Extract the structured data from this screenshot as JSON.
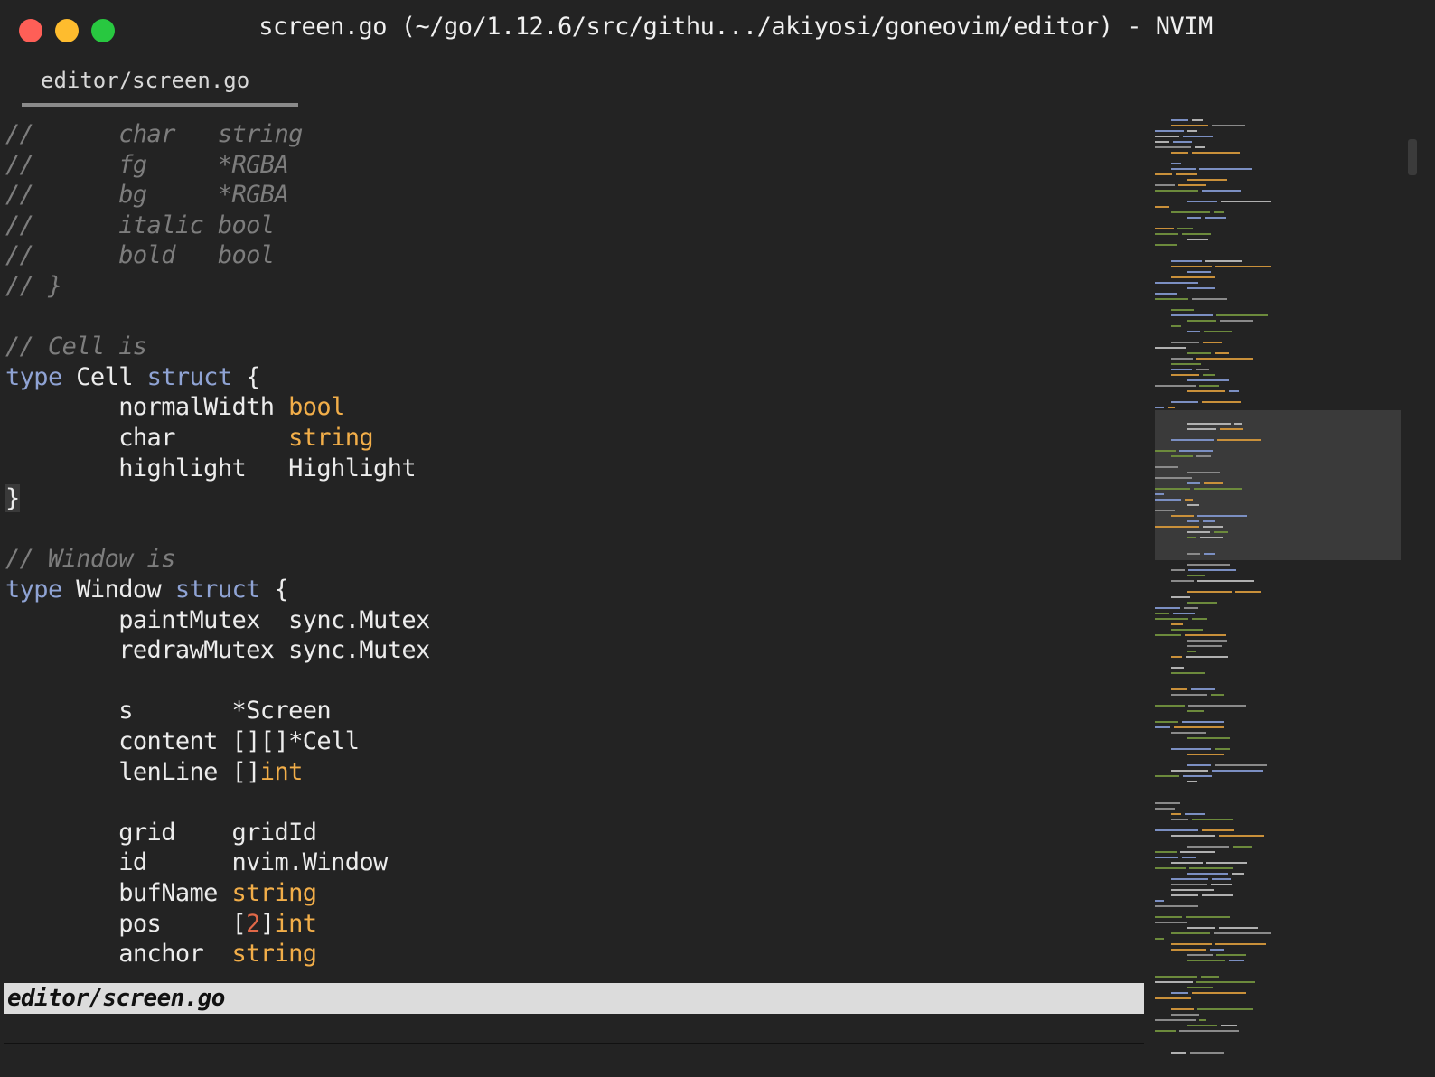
{
  "window": {
    "title": "screen.go (~/go/1.12.6/src/githu.../akiyosi/goneovim/editor) - NVIM"
  },
  "tabs": [
    {
      "label": "editor/screen.go",
      "active": true
    }
  ],
  "code": [
    [
      {
        "t": "//      char   string",
        "c": "c"
      }
    ],
    [
      {
        "t": "//      fg     *RGBA",
        "c": "c"
      }
    ],
    [
      {
        "t": "//      bg     *RGBA",
        "c": "c"
      }
    ],
    [
      {
        "t": "//      italic bool",
        "c": "c"
      }
    ],
    [
      {
        "t": "//      bold   bool",
        "c": "c"
      }
    ],
    [
      {
        "t": "// }",
        "c": "c"
      }
    ],
    [],
    [
      {
        "t": "// Cell is",
        "c": "c"
      }
    ],
    [
      {
        "t": "type",
        "c": "kw"
      },
      {
        "t": " Cell ",
        "c": "id"
      },
      {
        "t": "struct",
        "c": "kw"
      },
      {
        "t": " {",
        "c": "id"
      }
    ],
    [
      {
        "t": "        normalWidth ",
        "c": "id"
      },
      {
        "t": "bool",
        "c": "ty"
      }
    ],
    [
      {
        "t": "        char        ",
        "c": "id"
      },
      {
        "t": "string",
        "c": "ty"
      }
    ],
    [
      {
        "t": "        highlight   Highlight",
        "c": "id"
      }
    ],
    [
      {
        "t": "}",
        "c": "id brace-hl"
      }
    ],
    [],
    [
      {
        "t": "// Window is",
        "c": "c"
      }
    ],
    [
      {
        "t": "type",
        "c": "kw"
      },
      {
        "t": " Window ",
        "c": "id"
      },
      {
        "t": "struct",
        "c": "kw"
      },
      {
        "t": " {",
        "c": "id"
      }
    ],
    [
      {
        "t": "        paintMutex  sync.Mutex",
        "c": "id"
      }
    ],
    [
      {
        "t": "        redrawMutex sync.Mutex",
        "c": "id"
      }
    ],
    [],
    [
      {
        "t": "        s       *Screen",
        "c": "id"
      }
    ],
    [
      {
        "t": "        content [][]*Cell",
        "c": "id"
      }
    ],
    [
      {
        "t": "        lenLine []",
        "c": "id"
      },
      {
        "t": "int",
        "c": "ty"
      }
    ],
    [],
    [
      {
        "t": "        grid    gridId",
        "c": "id"
      }
    ],
    [
      {
        "t": "        id      nvim.Window",
        "c": "id"
      }
    ],
    [
      {
        "t": "        bufName ",
        "c": "id"
      },
      {
        "t": "string",
        "c": "ty"
      }
    ],
    [
      {
        "t": "        pos     [",
        "c": "id"
      },
      {
        "t": "2",
        "c": "num"
      },
      {
        "t": "]",
        "c": "id"
      },
      {
        "t": "int",
        "c": "ty"
      }
    ],
    [
      {
        "t": "        anchor  ",
        "c": "id"
      },
      {
        "t": "string",
        "c": "ty"
      }
    ]
  ],
  "statusline": {
    "filename": "editor/screen.go"
  },
  "colors": {
    "background": "#232323",
    "comment": "#7d7d7d",
    "keyword": "#8fa3d4",
    "type": "#f2ae49",
    "number": "#e06848",
    "identifier": "#ececec",
    "statusline_bg": "#dcdcdc"
  }
}
